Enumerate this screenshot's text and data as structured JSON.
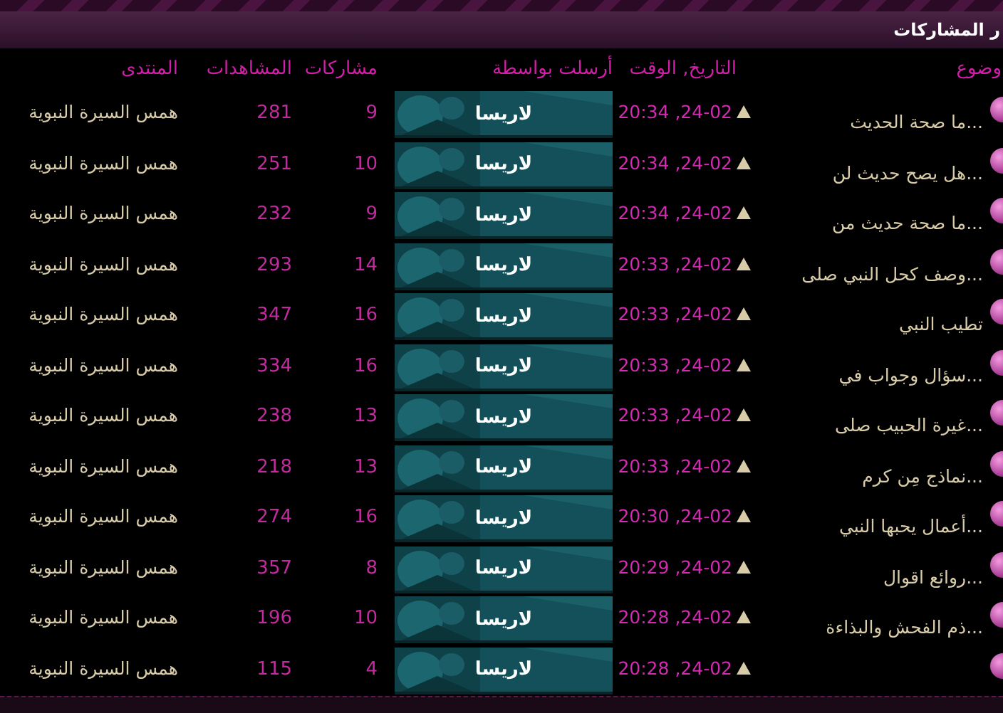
{
  "title": "ر المشاركات",
  "columns": [
    "وضوع",
    "التاريخ, الوقت",
    "أرسلت بواسطة",
    "مشاركات",
    "المشاهدات",
    "المنتدى"
  ],
  "rows": [
    {
      "topic": "ما صحة الحديث...",
      "date": "24-02, 20:34",
      "poster": "لاريسا",
      "posts": "9",
      "views": "281",
      "forum": "همس السيرة النبوية"
    },
    {
      "topic": "هل يصح حديث لن...",
      "date": "24-02, 20:34",
      "poster": "لاريسا",
      "posts": "10",
      "views": "251",
      "forum": "همس السيرة النبوية"
    },
    {
      "topic": "ما صحة حديث من...",
      "date": "24-02, 20:34",
      "poster": "لاريسا",
      "posts": "9",
      "views": "232",
      "forum": "همس السيرة النبوية"
    },
    {
      "topic": "وصف كحل النبي صلى...",
      "date": "24-02, 20:33",
      "poster": "لاريسا",
      "posts": "14",
      "views": "293",
      "forum": "همس السيرة النبوية"
    },
    {
      "topic": "تطيب النبي",
      "date": "24-02, 20:33",
      "poster": "لاريسا",
      "posts": "16",
      "views": "347",
      "forum": "همس السيرة النبوية"
    },
    {
      "topic": "سؤال وجواب في...",
      "date": "24-02, 20:33",
      "poster": "لاريسا",
      "posts": "16",
      "views": "334",
      "forum": "همس السيرة النبوية"
    },
    {
      "topic": "غيرة الحبيب صلى...",
      "date": "24-02, 20:33",
      "poster": "لاريسا",
      "posts": "13",
      "views": "238",
      "forum": "همس السيرة النبوية"
    },
    {
      "topic": "نماذج مِن كرم...",
      "date": "24-02, 20:33",
      "poster": "لاريسا",
      "posts": "13",
      "views": "218",
      "forum": "همس السيرة النبوية"
    },
    {
      "topic": "أعمال يحبها النبي...",
      "date": "24-02, 20:30",
      "poster": "لاريسا",
      "posts": "16",
      "views": "274",
      "forum": "همس السيرة النبوية"
    },
    {
      "topic": "روائع اقوال...",
      "date": "24-02, 20:29",
      "poster": "لاريسا",
      "posts": "8",
      "views": "357",
      "forum": "همس السيرة النبوية"
    },
    {
      "topic": "ذم الفحش والبذاءة...",
      "date": "24-02, 20:28",
      "poster": "لاريسا",
      "posts": "10",
      "views": "196",
      "forum": "همس السيرة النبوية"
    },
    {
      "date": "24-02, 20:28",
      "poster": "لاريسا",
      "posts": "4",
      "views": "115",
      "forum": "همس السيرة النبوية"
    }
  ]
}
